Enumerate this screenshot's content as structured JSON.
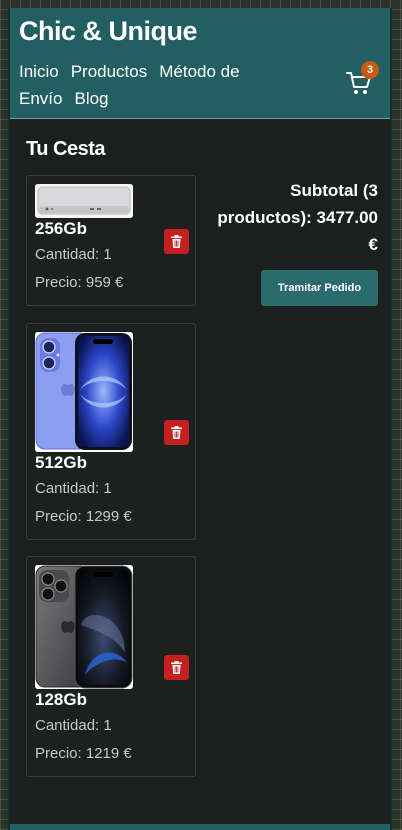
{
  "header": {
    "brand": "Chic & Unique",
    "nav": [
      "Inicio",
      "Productos",
      "Método de Envío",
      "Blog"
    ],
    "cart_count": "3"
  },
  "cart": {
    "title": "Tu Cesta",
    "items": [
      {
        "name": "256Gb",
        "quantity": "Cantidad: 1",
        "price": "Precio: 959 €",
        "image": "mac-mini"
      },
      {
        "name": "512Gb",
        "quantity": "Cantidad: 1",
        "price": "Precio: 1299 €",
        "image": "iphone-blue"
      },
      {
        "name": "128Gb",
        "quantity": "Cantidad: 1",
        "price": "Precio: 1219 €",
        "image": "iphone-titanium"
      }
    ],
    "subtotal": "Subtotal (3 productos): 3477.00 €",
    "checkout_label": "Tramitar Pedido"
  },
  "colors": {
    "header": "#235e63",
    "button": "#2a6b70",
    "delete": "#c42020",
    "badge": "#c85a12",
    "background": "#1b1f1e"
  }
}
